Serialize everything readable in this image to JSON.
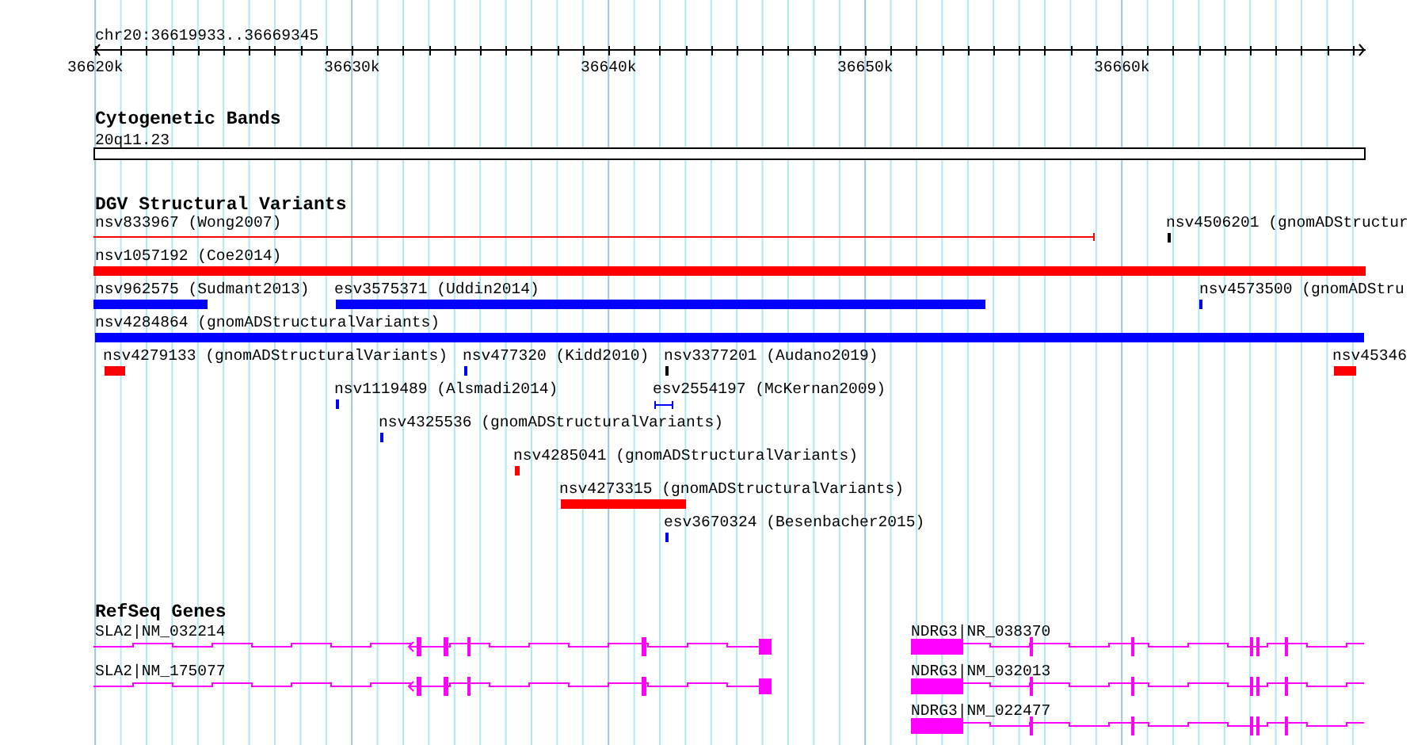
{
  "location": "chr20:36619933..36669345",
  "ruler": {
    "ticks": [
      "36620k",
      "36630k",
      "36640k",
      "36650k",
      "36660k"
    ]
  },
  "bands": {
    "title": "Cytogenetic Bands",
    "label": "20q11.23"
  },
  "variants": {
    "title": "DGV Structural Variants",
    "features": [
      {
        "label": "nsv833967 (Wong2007)",
        "color": "#ff0000"
      },
      {
        "label": "nsv4506201 (gnomADStructur",
        "color": "#000000"
      },
      {
        "label": "nsv1057192 (Coe2014)",
        "color": "#ff0000"
      },
      {
        "label": "nsv962575 (Sudmant2013)",
        "color": "#0000ff"
      },
      {
        "label": "esv3575371 (Uddin2014)",
        "color": "#0000ff"
      },
      {
        "label": "nsv4573500 (gnomADStru",
        "color": "#0000ff"
      },
      {
        "label": "nsv4284864 (gnomADStructuralVariants)",
        "color": "#0000ff"
      },
      {
        "label": "nsv4279133 (gnomADStructuralVariants)",
        "color": "#ff0000"
      },
      {
        "label": "nsv477320 (Kidd2010)",
        "color": "#0000ff"
      },
      {
        "label": "nsv3377201 (Audano2019)",
        "color": "#000000"
      },
      {
        "label": "nsv45346",
        "color": "#ff0000"
      },
      {
        "label": "nsv1119489 (Alsmadi2014)",
        "color": "#0000ff"
      },
      {
        "label": "esv2554197 (McKernan2009)",
        "color": "#0000ff"
      },
      {
        "label": "nsv4325536 (gnomADStructuralVariants)",
        "color": "#0000ff"
      },
      {
        "label": "nsv4285041 (gnomADStructuralVariants)",
        "color": "#ff0000"
      },
      {
        "label": "nsv4273315 (gnomADStructuralVariants)",
        "color": "#ff0000"
      },
      {
        "label": "esv3670324 (Besenbacher2015)",
        "color": "#0000ff"
      }
    ]
  },
  "genes": {
    "title": "RefSeq Genes",
    "features": [
      {
        "label": "SLA2|NM_032214"
      },
      {
        "label": "NDRG3|NR_038370"
      },
      {
        "label": "SLA2|NM_175077"
      },
      {
        "label": "NDRG3|NM_032013"
      },
      {
        "label": "NDRG3|NM_022477"
      }
    ]
  }
}
